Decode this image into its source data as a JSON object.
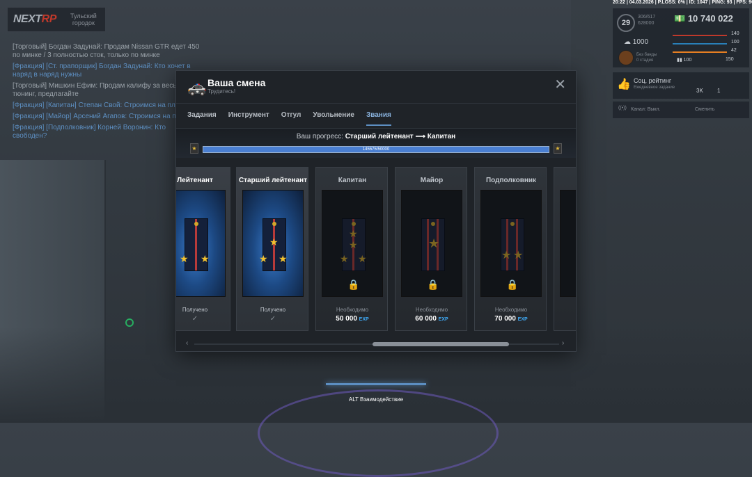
{
  "hud": {
    "logo_brand_prefix": "NEXT",
    "logo_brand_suffix": "RP",
    "logo_city": "Тульский городок",
    "stats_line": "20:22 | 04.03.2026 | P.LOSS: 0% | ID: 1047 | PING: 93 | FPS: 90",
    "level": "29",
    "exp_text": "306/617\n628000",
    "money": "10 740 022",
    "cash": "1000",
    "holding": "Без банды\n0 стадия",
    "health": "140",
    "armor_a": "100",
    "hunger": "42",
    "armor_b": "100",
    "armor_c": "150",
    "social_title": "Соц. рейтинг",
    "social_sub": "Ежедневное задание",
    "social_val1": "3K",
    "social_val2": "1",
    "channel": "Канал: Выкл.",
    "channel_action": "Сменить",
    "interaction": "ALT Взаимодействие"
  },
  "chat": {
    "lines": [
      {
        "text": "[Торговый] Богдан Задунай: Продам Nissan GTR едет 450 по минке / 3 полностью сток, только по минке",
        "tone": "grey"
      },
      {
        "text": "[Фракция] [Ст. прапорщик] Богдан Задунай: Кто хочет в наряд в наряд нужны",
        "tone": "blue"
      },
      {
        "text": "[Торговый] Мишкин Ефим: Продам калифу за весь тюнинг, предлагайте",
        "tone": "grey"
      },
      {
        "text": "[Фракция] [Капитан] Степан Свой: Строимся на плацу",
        "tone": "blue"
      },
      {
        "text": "[Фракция] [Майор] Арсений Агапов: Строимся на плацу",
        "tone": "blue"
      },
      {
        "text": "[Фракция] [Подполковник] Корней Воронин: Кто свободен?",
        "tone": "blue"
      }
    ]
  },
  "modal": {
    "title": "Ваша смена",
    "subtitle": "Трудитесь!",
    "tabs": [
      {
        "label": "Задания"
      },
      {
        "label": "Инструмент"
      },
      {
        "label": "Отгул"
      },
      {
        "label": "Увольнение"
      },
      {
        "label": "Звания"
      }
    ],
    "progress_prefix": "Ваш прогресс:",
    "progress_route": "Старший лейтенант ⟶ Капитан",
    "progress_fraction": 1.0,
    "progress_text": "145575/50000",
    "cards": [
      {
        "name": "Лейтенант",
        "status": "Получено",
        "acquired": true
      },
      {
        "name": "Старший лейтенант",
        "status": "Получено",
        "acquired": true
      },
      {
        "name": "Капитан",
        "need_label": "Необходимо",
        "price": "50 000",
        "unit": "EXP",
        "acquired": false
      },
      {
        "name": "Майор",
        "need_label": "Необходимо",
        "price": "60 000",
        "unit": "EXP",
        "acquired": false
      },
      {
        "name": "Подполковник",
        "need_label": "Необходимо",
        "price": "70 000",
        "unit": "EXP",
        "acquired": false
      }
    ]
  }
}
